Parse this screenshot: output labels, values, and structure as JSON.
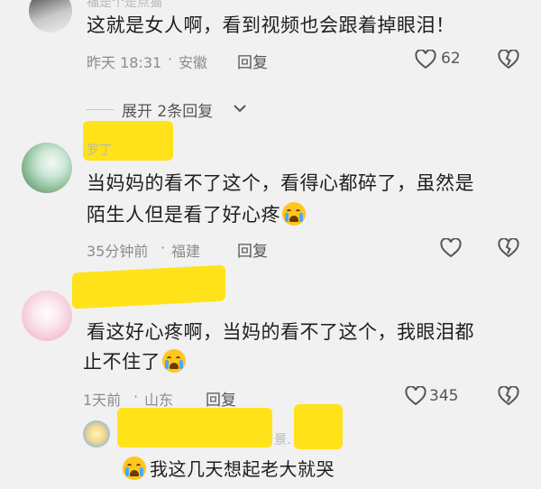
{
  "comments": [
    {
      "name_fragment": "福是个是点猫",
      "text": "这就是女人啊，看到视频也会跟着掉眼泪！",
      "time": "昨天 18:31",
      "location": "安徽",
      "reply_label": "回复",
      "likes": "62"
    },
    {
      "name_fragment": "罗丁",
      "text_line1": "当妈妈的看不了这个，看得心都碎了，虽然是",
      "text_line2": "陌生人但是看了好心疼",
      "time": "35分钟前",
      "location": "福建",
      "reply_label": "回复"
    },
    {
      "name_fragment": "",
      "text_line1": "看这好心疼啊，当妈的看不了这个，我眼泪都",
      "text_line2": "止不住了",
      "time": "1天前",
      "location": "山东",
      "reply_label": "回复",
      "likes": "345"
    }
  ],
  "expand_replies": "展开 2条回复",
  "sub_reply": {
    "name_fragment": "景.",
    "text": "我这几天想起老大就哭"
  },
  "colors": {
    "background": "#f1f1f1",
    "highlight": "#ffe21a",
    "meta": "#8c8c8c"
  }
}
